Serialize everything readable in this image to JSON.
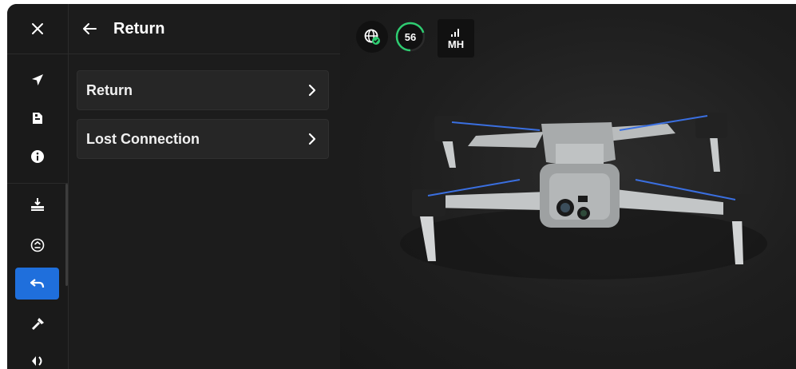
{
  "rail": {
    "close_icon": "close-icon",
    "items": [
      {
        "name": "rail-item-navigate",
        "icon": "navigation-arrow-icon"
      },
      {
        "name": "rail-item-file",
        "icon": "file-icon"
      },
      {
        "name": "rail-item-info",
        "icon": "info-icon"
      },
      {
        "name": "rail-item-landing",
        "icon": "landing-icon"
      },
      {
        "name": "rail-item-hover",
        "icon": "hover-icon"
      },
      {
        "name": "rail-item-return",
        "icon": "return-icon",
        "active": true
      },
      {
        "name": "rail-item-flashlight",
        "icon": "flashlight-icon"
      },
      {
        "name": "rail-item-obstacle",
        "icon": "obstacle-icon"
      }
    ]
  },
  "panel": {
    "title": "Return",
    "rows": [
      {
        "label": "Return"
      },
      {
        "label": "Lost Connection"
      }
    ]
  },
  "status": {
    "timer_value": "56",
    "timer_fraction": 0.7,
    "signal_label": "MH"
  },
  "colors": {
    "accent": "#1f6fdc",
    "success": "#2ecc71",
    "panel_bg": "#1c1c1c",
    "row_bg": "#262626"
  }
}
